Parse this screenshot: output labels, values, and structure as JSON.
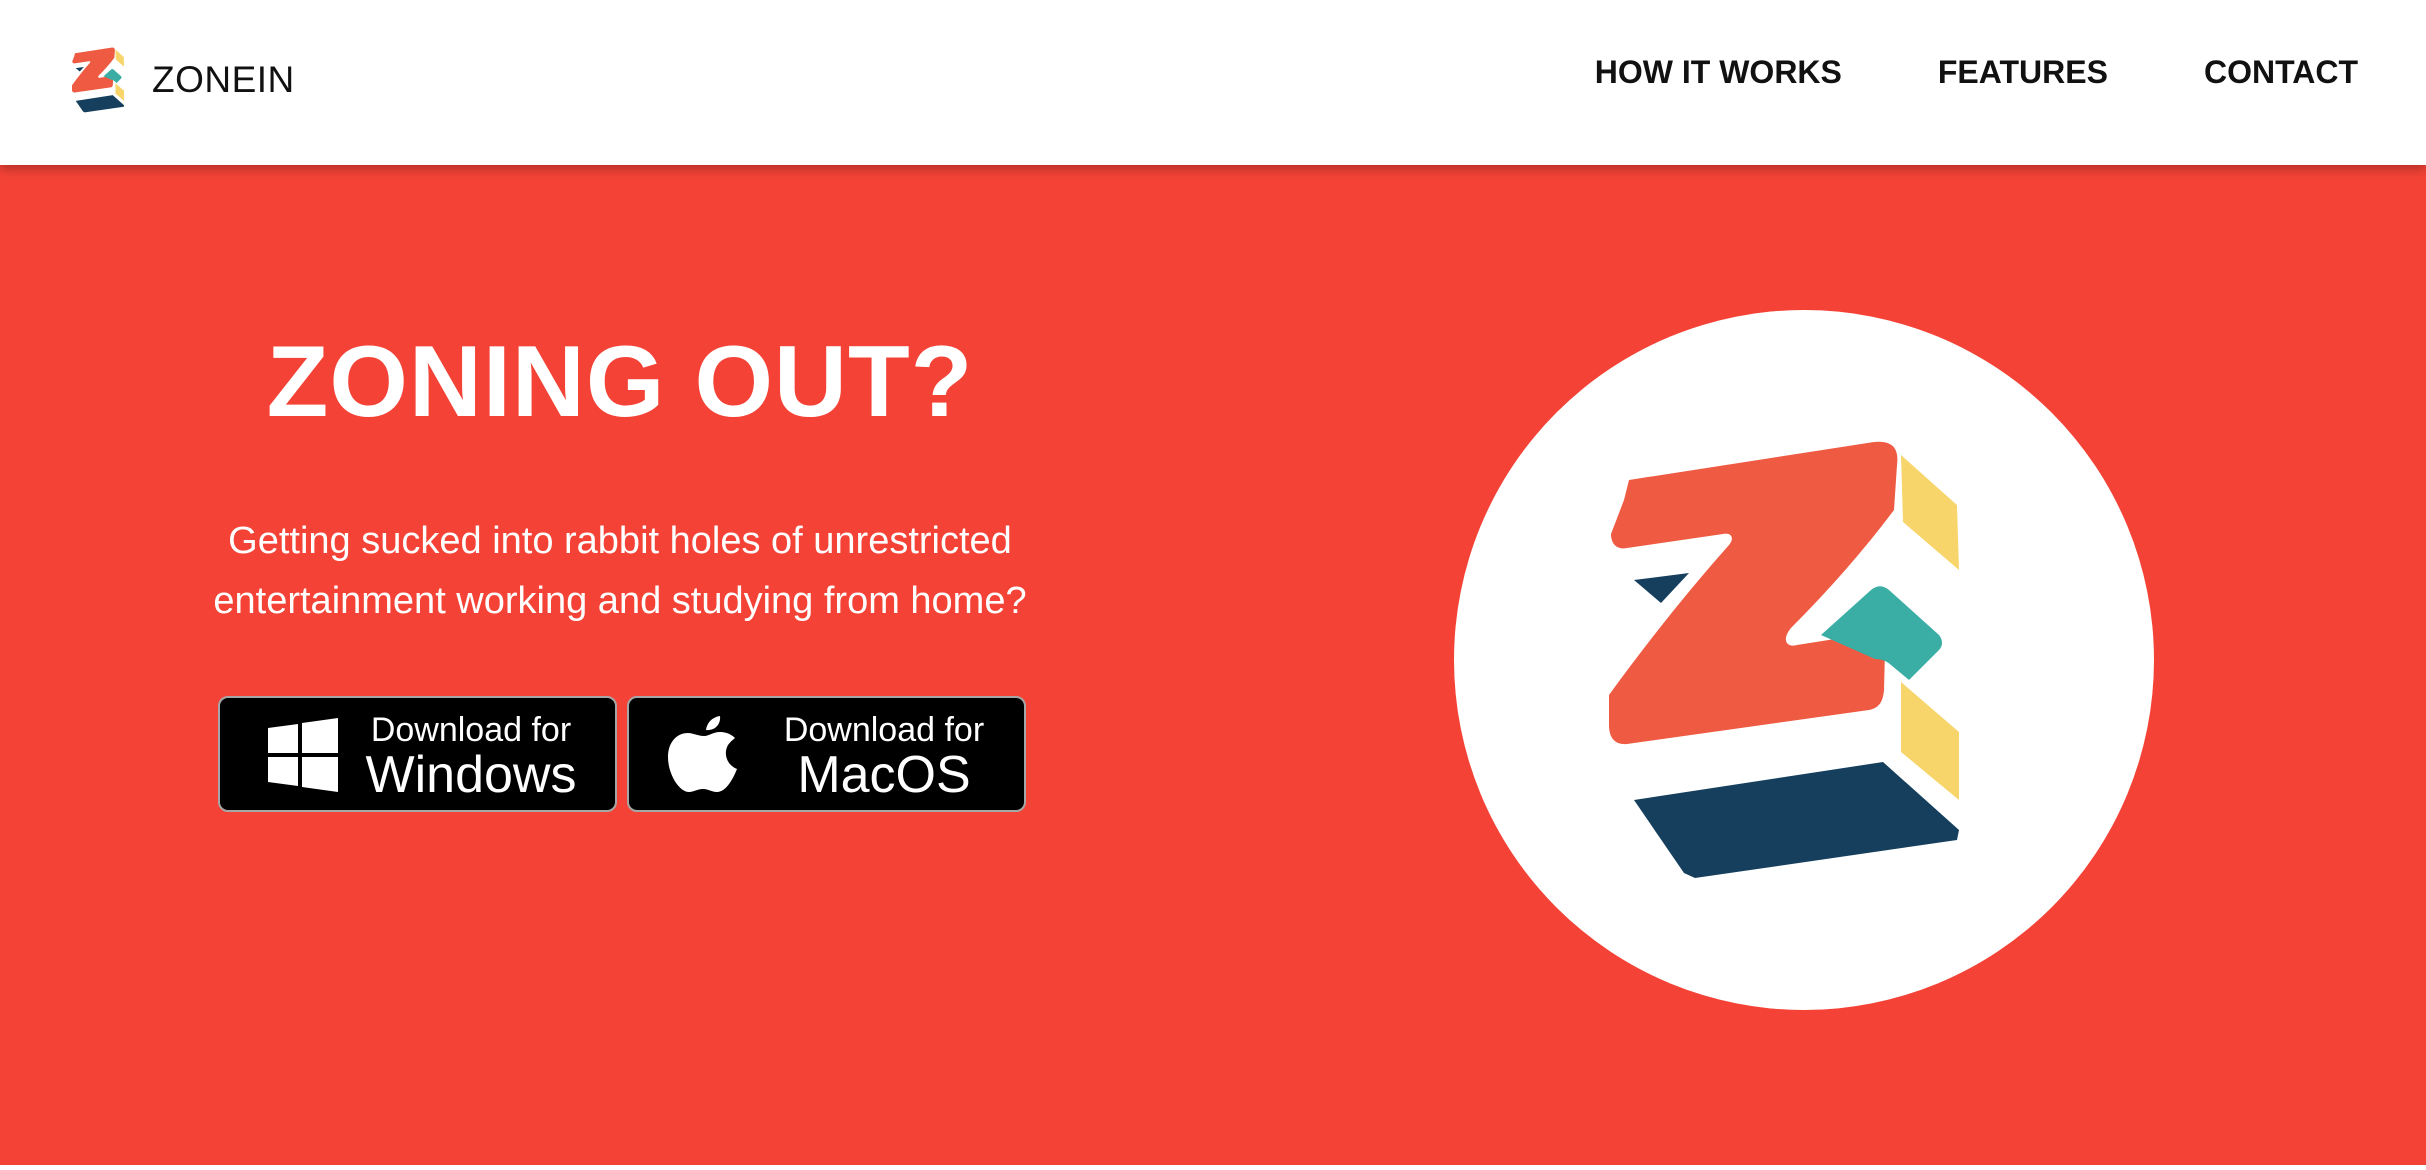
{
  "brand": {
    "name": "ZONEIN",
    "logo_icon": "zonein-logo-icon"
  },
  "nav": {
    "items": [
      {
        "label": "HOW IT WORKS"
      },
      {
        "label": "FEATURES"
      },
      {
        "label": "CONTACT"
      }
    ]
  },
  "hero": {
    "title": "ZONING OUT?",
    "subtitle_line1": "Getting sucked into rabbit holes of unrestricted",
    "subtitle_line2": "entertainment working and studying from home?",
    "buttons": {
      "windows": {
        "line1": "Download for",
        "line2": "Windows",
        "icon": "windows-icon"
      },
      "macos": {
        "line1": "Download for",
        "line2": "MacOS",
        "icon": "apple-icon"
      }
    }
  },
  "colors": {
    "hero_background": "#f44336",
    "logo_red": "#ef5a42",
    "logo_yellow": "#f7d56b",
    "logo_teal": "#3aaea4",
    "logo_navy": "#153f5c",
    "button_background": "#000000"
  }
}
